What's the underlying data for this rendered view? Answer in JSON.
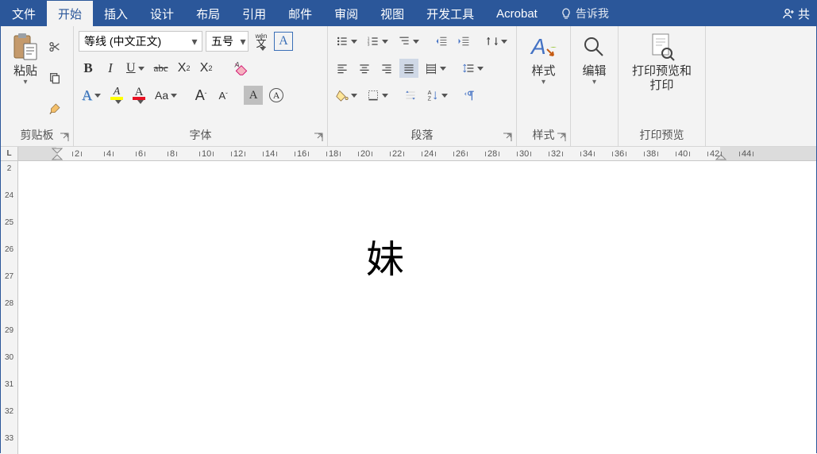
{
  "tabs": {
    "file": "文件",
    "home": "开始",
    "insert": "插入",
    "design": "设计",
    "layout": "布局",
    "references": "引用",
    "mailings": "邮件",
    "review": "审阅",
    "view": "视图",
    "developer": "开发工具",
    "acrobat": "Acrobat",
    "tell_me": "告诉我",
    "share": "共"
  },
  "clipboard": {
    "paste": "粘贴",
    "group_label": "剪贴板"
  },
  "font": {
    "name": "等线 (中文正文)",
    "size": "五号",
    "phonetic": "文",
    "phonetic_top": "wén",
    "charborder": "A",
    "bold": "B",
    "italic": "I",
    "underline": "U",
    "strike": "abc",
    "sub": "X",
    "sup": "X",
    "textfx": "A",
    "highlight": "A",
    "fontcolor": "A",
    "changecase": "Aa",
    "grow": "A",
    "shrink": "A",
    "charshade": "A",
    "enclose": "A",
    "clear": "A",
    "group_label": "字体"
  },
  "paragraph": {
    "group_label": "段落"
  },
  "styles": {
    "label": "样式",
    "group_label": "样式"
  },
  "editing": {
    "label": "编辑"
  },
  "print": {
    "label_line1": "打印预览和",
    "label_line2": "打印",
    "group_label": "打印预览"
  },
  "ruler": {
    "h_ticks": [
      2,
      4,
      6,
      8,
      10,
      12,
      14,
      16,
      18,
      20,
      22,
      24,
      26,
      28,
      30,
      32,
      34,
      36,
      38,
      40,
      42,
      44
    ],
    "v_ticks": [
      2,
      24,
      25,
      26,
      27,
      28,
      29,
      30,
      31,
      32,
      33
    ]
  },
  "document": {
    "text": "妹"
  }
}
